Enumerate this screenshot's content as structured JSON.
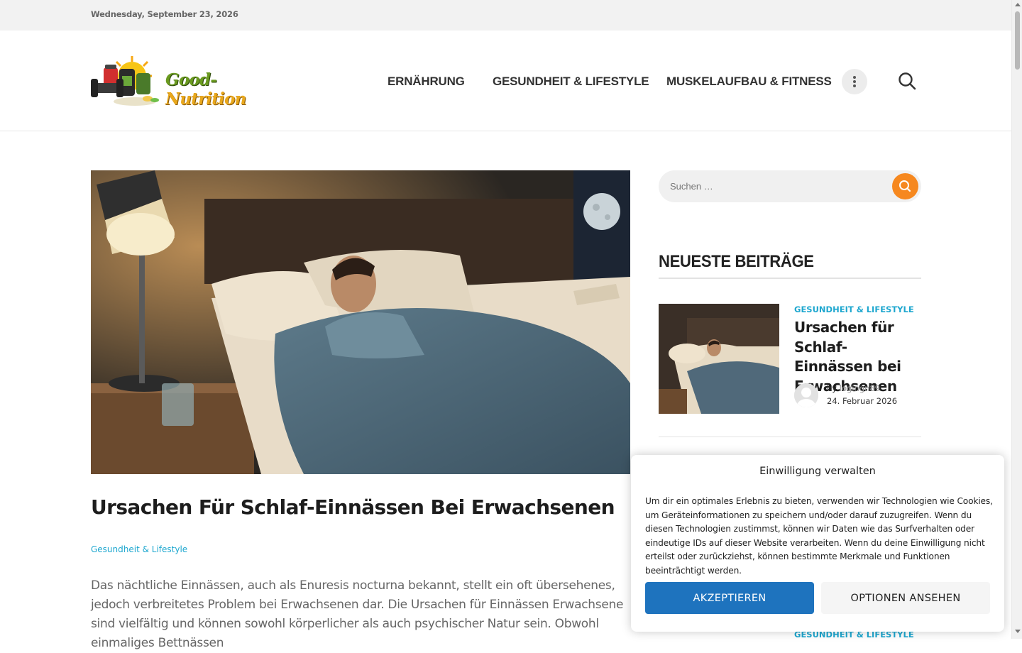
{
  "topbar": {
    "date": "Wednesday, September 23, 2026"
  },
  "header": {
    "logo": {
      "text_main": "Good-",
      "text_accent": "Nutrition"
    },
    "nav": [
      {
        "label": "ERNÄHRUNG"
      },
      {
        "label": "GESUNDHEIT & LIFESTYLE"
      },
      {
        "label": "MUSKELAUFBAU & FITNESS"
      }
    ],
    "more_icon": "dots-vertical-icon",
    "search_icon": "search-icon"
  },
  "post": {
    "image_alt": "Mann schläft im Bett bei Nacht",
    "title": "Ursachen Für Schlaf-Einnässen Bei Erwachsenen",
    "category": "Gesundheit & Lifestyle",
    "excerpt": "Das nächtliche Einnässen, auch als Enuresis nocturna bekannt, stellt ein oft übersehenes, jedoch verbreitetes Problem bei Erwachsenen dar. Die Ursachen für Einnässen Erwachsene sind vielfältig und können sowohl körperlicher als auch psychischer Natur sein. Obwohl einmaliges Bettnässen"
  },
  "sidebar": {
    "search": {
      "placeholder": "Suchen …"
    },
    "widget_title": "NEUESTE BEITRÄGE",
    "recent_posts": [
      {
        "category": "GESUNDHEIT & LIFESTYLE",
        "title": "Ursachen für Schlaf-Einnässen bei Erwachsenen",
        "by": "by",
        "author": "logingn89",
        "date": "24. Februar 2026"
      },
      {
        "category": "GESUNDHEIT & LIFESTYLE"
      }
    ]
  },
  "consent": {
    "title": "Einwilligung verwalten",
    "text": "Um dir ein optimales Erlebnis zu bieten, verwenden wir Technologien wie Cookies, um Geräteinformationen zu speichern und/oder darauf zuzugreifen. Wenn du diesen Technologien zustimmst, können wir Daten wie das Surfverhalten oder eindeutige IDs auf dieser Website verarbeiten. Wenn du deine Einwilligung nicht erteilst oder zurückziehst, können bestimmte Merkmale und Funktionen beeinträchtigt werden.",
    "accept_label": "AKZEPTIEREN",
    "options_label": "OPTIONEN ANSEHEN"
  },
  "colors": {
    "accent_orange": "#f6881f",
    "category_blue": "#1ea7cf",
    "accept_blue": "#1e73be"
  }
}
